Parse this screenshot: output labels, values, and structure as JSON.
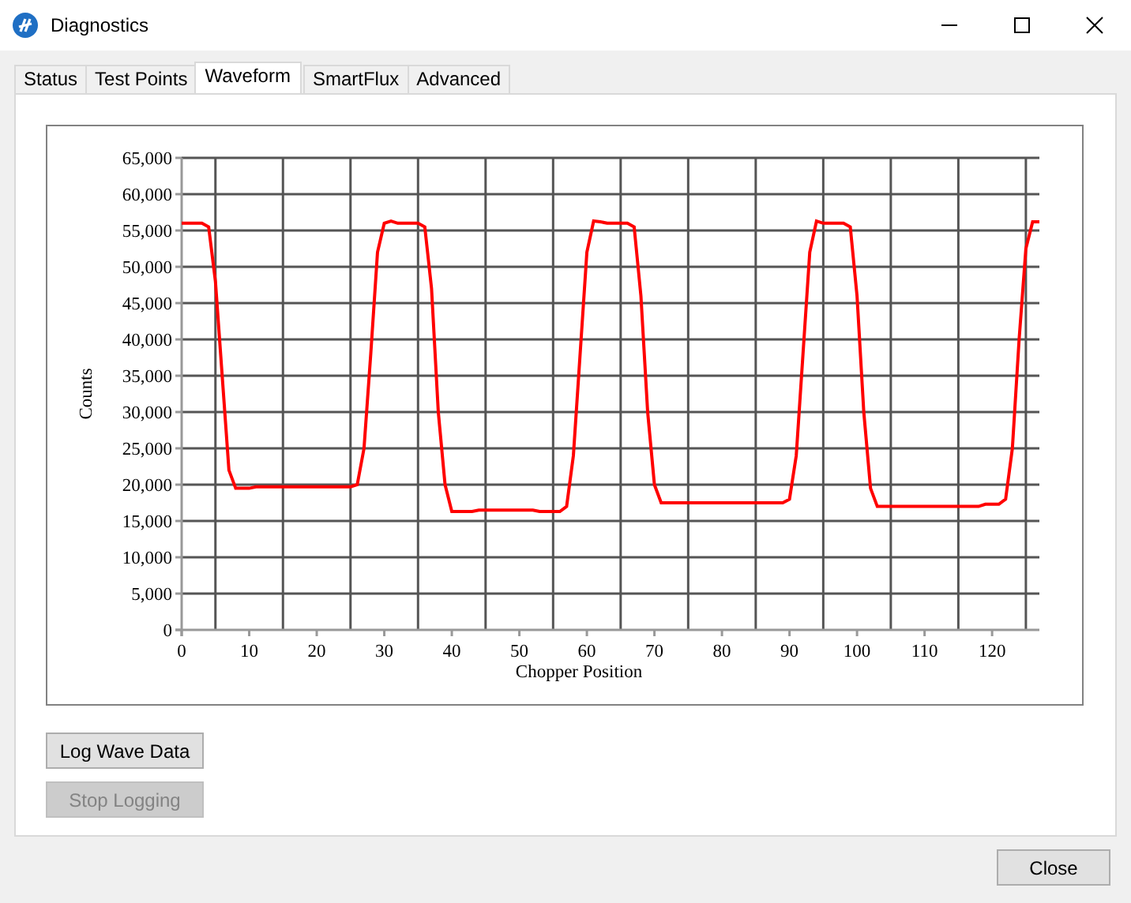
{
  "window": {
    "title": "Diagnostics"
  },
  "tabs": [
    {
      "label": "Status",
      "selected": false
    },
    {
      "label": "Test Points",
      "selected": false
    },
    {
      "label": "Waveform",
      "selected": true
    },
    {
      "label": "SmartFlux",
      "selected": false
    },
    {
      "label": "Advanced",
      "selected": false
    }
  ],
  "chart_data": {
    "type": "line",
    "xlabel": "Chopper Position",
    "ylabel": "Counts",
    "grid": true,
    "xlim": [
      0,
      127
    ],
    "ylim": [
      0,
      65000
    ],
    "x": [
      0,
      1,
      2,
      3,
      4,
      5,
      6,
      7,
      8,
      9,
      10,
      11,
      12,
      13,
      14,
      15,
      16,
      17,
      18,
      19,
      20,
      21,
      22,
      23,
      24,
      25,
      26,
      27,
      28,
      29,
      30,
      31,
      32,
      33,
      34,
      35,
      36,
      37,
      38,
      39,
      40,
      41,
      42,
      43,
      44,
      45,
      46,
      47,
      48,
      49,
      50,
      51,
      52,
      53,
      54,
      55,
      56,
      57,
      58,
      59,
      60,
      61,
      62,
      63,
      64,
      65,
      66,
      67,
      68,
      69,
      70,
      71,
      72,
      73,
      74,
      75,
      76,
      77,
      78,
      79,
      80,
      81,
      82,
      83,
      84,
      85,
      86,
      87,
      88,
      89,
      90,
      91,
      92,
      93,
      94,
      95,
      96,
      97,
      98,
      99,
      100,
      101,
      102,
      103,
      104,
      105,
      106,
      107,
      108,
      109,
      110,
      111,
      112,
      113,
      114,
      115,
      116,
      117,
      118,
      119,
      120,
      121,
      122,
      123,
      124,
      125,
      126,
      127
    ],
    "xticks": [
      0,
      10,
      20,
      30,
      40,
      50,
      60,
      70,
      80,
      90,
      100,
      110,
      120
    ],
    "yticks": [
      {
        "value": 0,
        "label": "0"
      },
      {
        "value": 5000,
        "label": "5,000"
      },
      {
        "value": 10000,
        "label": "10,000"
      },
      {
        "value": 15000,
        "label": "15,000"
      },
      {
        "value": 20000,
        "label": "20,000"
      },
      {
        "value": 25000,
        "label": "25,000"
      },
      {
        "value": 30000,
        "label": "30,000"
      },
      {
        "value": 35000,
        "label": "35,000"
      },
      {
        "value": 40000,
        "label": "40,000"
      },
      {
        "value": 45000,
        "label": "45,000"
      },
      {
        "value": 50000,
        "label": "50,000"
      },
      {
        "value": 55000,
        "label": "55,000"
      },
      {
        "value": 60000,
        "label": "60,000"
      },
      {
        "value": 65000,
        "label": "65,000"
      }
    ],
    "series": [
      {
        "color": "#ff0000",
        "values": [
          56000,
          56000,
          56000,
          56000,
          55500,
          48000,
          35000,
          22000,
          19500,
          19500,
          19500,
          19700,
          19700,
          19700,
          19700,
          19700,
          19700,
          19700,
          19700,
          19700,
          19700,
          19700,
          19700,
          19700,
          19700,
          19700,
          20000,
          25000,
          38000,
          52000,
          56000,
          56300,
          56000,
          56000,
          56000,
          56000,
          55500,
          47000,
          30000,
          20000,
          16300,
          16300,
          16300,
          16300,
          16500,
          16500,
          16500,
          16500,
          16500,
          16500,
          16500,
          16500,
          16500,
          16300,
          16300,
          16300,
          16300,
          17000,
          24000,
          38000,
          52000,
          56300,
          56200,
          56000,
          56000,
          56000,
          56000,
          55500,
          46000,
          30000,
          20000,
          17500,
          17500,
          17500,
          17500,
          17500,
          17500,
          17500,
          17500,
          17500,
          17500,
          17500,
          17500,
          17500,
          17500,
          17500,
          17500,
          17500,
          17500,
          17500,
          18000,
          24000,
          38000,
          52000,
          56300,
          56000,
          56000,
          56000,
          56000,
          55500,
          46000,
          30000,
          19500,
          17000,
          17000,
          17000,
          17000,
          17000,
          17000,
          17000,
          17000,
          17000,
          17000,
          17000,
          17000,
          17000,
          17000,
          17000,
          17000,
          17300,
          17300,
          17300,
          18000,
          25000,
          40000,
          52500,
          56200,
          56200
        ]
      }
    ]
  },
  "buttons": [
    {
      "label": "Log Wave Data",
      "disabled": false
    },
    {
      "label": "Stop Logging",
      "disabled": true
    }
  ],
  "footer": {
    "close_button": "Close"
  }
}
